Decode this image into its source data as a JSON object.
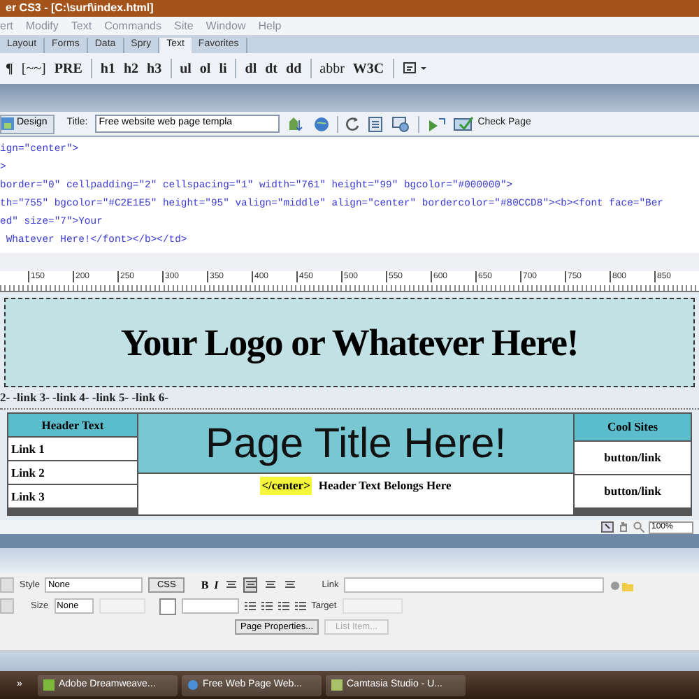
{
  "window": {
    "title": "er CS3 - [C:\\surf\\index.html]"
  },
  "menu": [
    "ert",
    "Modify",
    "Text",
    "Commands",
    "Site",
    "Window",
    "Help"
  ],
  "insert_tabs": [
    {
      "label": "Layout",
      "selected": false
    },
    {
      "label": "Forms",
      "selected": false
    },
    {
      "label": "Data",
      "selected": false
    },
    {
      "label": "Spry",
      "selected": false
    },
    {
      "label": "Text",
      "selected": true
    },
    {
      "label": "Favorites",
      "selected": false
    }
  ],
  "text_toolbar_groups": [
    [
      "¶",
      "[~~]",
      "PRE"
    ],
    [
      "h1",
      "h2",
      "h3"
    ],
    [
      "ul",
      "ol",
      "li"
    ],
    [
      "dl",
      "dt",
      "dd"
    ],
    [
      "abbr",
      "W3C"
    ]
  ],
  "document_toolbar": {
    "design_button": "Design",
    "title_label": "Title:",
    "title_value": "Free website web page templa",
    "check_page": "Check Page"
  },
  "code_lines": [
    "ign=\"center\">",
    ">",
    "border=\"0\" cellpadding=\"2\" cellspacing=\"1\" width=\"761\" height=\"99\" bgcolor=\"#000000\">",
    "th=\"755\" bgcolor=\"#C2E1E5\" height=\"95\" valign=\"middle\" align=\"center\" bordercolor=\"#80CCD8\"><b><font face=\"Ber",
    "ed\" size=\"7\">Your",
    " Whatever Here!</font></b></td>"
  ],
  "ruler_labels": [
    "150",
    "200",
    "250",
    "300",
    "350",
    "400",
    "450",
    "500",
    "550",
    "600",
    "650",
    "700",
    "750",
    "800",
    "850"
  ],
  "design": {
    "logo": "Your Logo or Whatever Here!",
    "nav_links": "2- -link 3- -link 4- -link 5- -link 6-",
    "left_header": "Header Text",
    "left_links": [
      "Link 1",
      "Link 2",
      "Link 3"
    ],
    "page_title": "Page Title Here!",
    "center_tag": "</center>",
    "center_text": "Header Text Belongs Here",
    "right_header": "Cool Sites",
    "right_links": [
      "button/link",
      "button/link"
    ]
  },
  "status_bar": {
    "zoom": "100%"
  },
  "properties": {
    "style_label": "Style",
    "style_value": "None",
    "css_button": "CSS",
    "bold": "B",
    "italic": "I",
    "align_buttons": [
      {
        "selected": false
      },
      {
        "selected": true
      },
      {
        "selected": false
      },
      {
        "selected": false
      }
    ],
    "link_label": "Link",
    "size_label": "Size",
    "size_value": "None",
    "target_label": "Target",
    "page_properties": "Page Properties...",
    "list_item": "List Item..."
  },
  "taskbar": {
    "overflow": "»",
    "tasks": [
      "Adobe Dreamweave...",
      "Free Web Page Web...",
      "Camtasia Studio - U..."
    ]
  }
}
